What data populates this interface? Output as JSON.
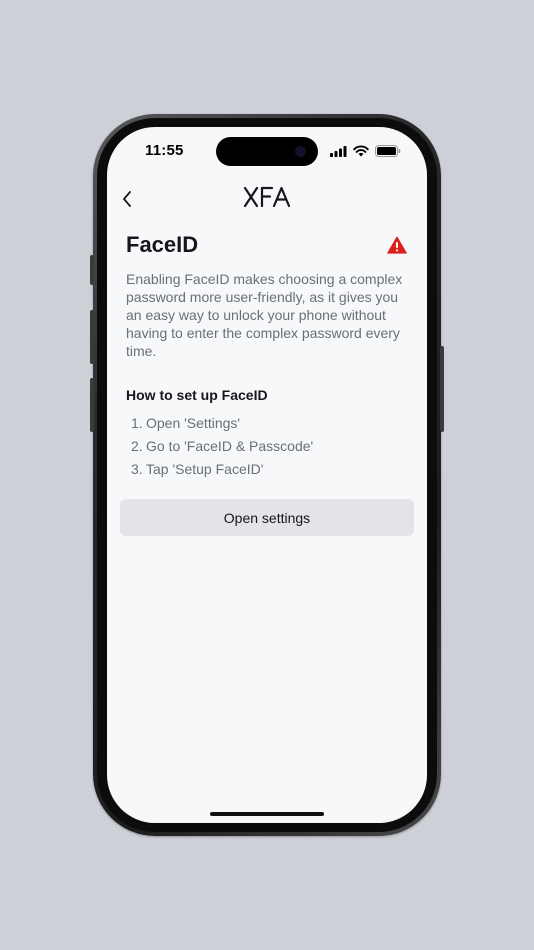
{
  "status_bar": {
    "time": "11:55",
    "icons": [
      "signal-icon",
      "wifi-icon",
      "battery-icon"
    ]
  },
  "nav": {
    "back_icon": "chevron-left-icon",
    "logo_text": "XFA"
  },
  "content": {
    "title": "FaceID",
    "warning_icon": "warning-triangle-icon",
    "description": "Enabling FaceID makes choosing a complex password more user-friendly, as it gives you an easy way to unlock your phone without having to enter the complex password every time.",
    "howto_title": "How to set up FaceID",
    "steps": [
      {
        "num": "1.",
        "text": "Open 'Settings'"
      },
      {
        "num": "2.",
        "text": "Go to 'FaceID & Passcode'"
      },
      {
        "num": "3.",
        "text": "Tap 'Setup FaceID'"
      }
    ],
    "button_label": "Open settings"
  },
  "colors": {
    "background": "#cdd0d6",
    "screen": "#f7f8fa",
    "warning": "#e0201a",
    "button_bg": "#e3e4e7",
    "text_primary": "#15171a",
    "text_secondary": "#6a6e78"
  }
}
